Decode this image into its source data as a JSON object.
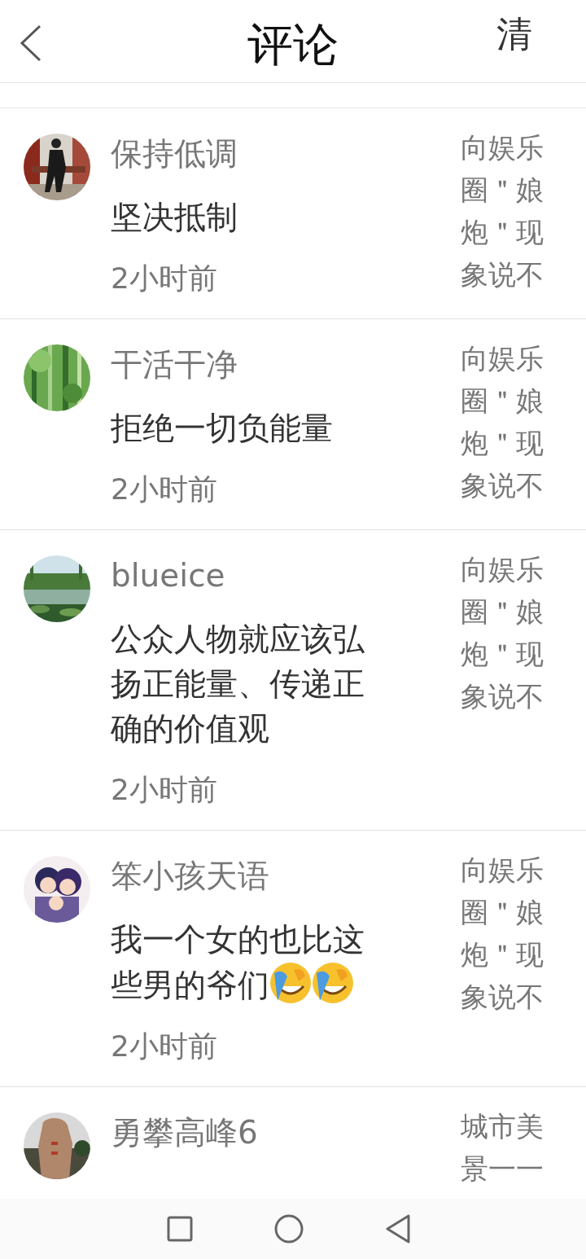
{
  "header": {
    "back_button": {
      "kind": "chevron"
    },
    "title": "评论",
    "action": "清"
  },
  "comments": [
    {
      "avatar": {
        "kind": "picture"
      },
      "name": "保持低调",
      "body": "坚决抵制",
      "time": "2小时前",
      "topic": "向娱乐圈＂娘炮＂现象说不"
    },
    {
      "avatar": {
        "kind": "picture"
      },
      "name": "干活干净",
      "body": "拒绝一切负能量",
      "time": "2小时前",
      "topic": "向娱乐圈＂娘炮＂现象说不"
    },
    {
      "avatar": {
        "kind": "picture"
      },
      "name": "blueice",
      "body": "公众人物就应该弘扬正能量、传递正确的价值观",
      "time": "2小时前",
      "topic": "向娱乐圈＂娘炮＂现象说不"
    },
    {
      "avatar": {
        "kind": "picture"
      },
      "name": "笨小孩天语",
      "body": "我一个女的也比这些男的爷们",
      "emojis": [
        {
          "kind": "laugh"
        },
        {
          "kind": "laugh"
        }
      ],
      "time": "2小时前",
      "topic": "向娱乐圈＂娘炮＂现象说不"
    },
    {
      "avatar": {
        "kind": "picture"
      },
      "name": "勇攀高峰6",
      "topic": "城市美景一一"
    }
  ],
  "nav": [
    {
      "kind": "square"
    },
    {
      "kind": "circle"
    },
    {
      "kind": "triangle"
    }
  ]
}
